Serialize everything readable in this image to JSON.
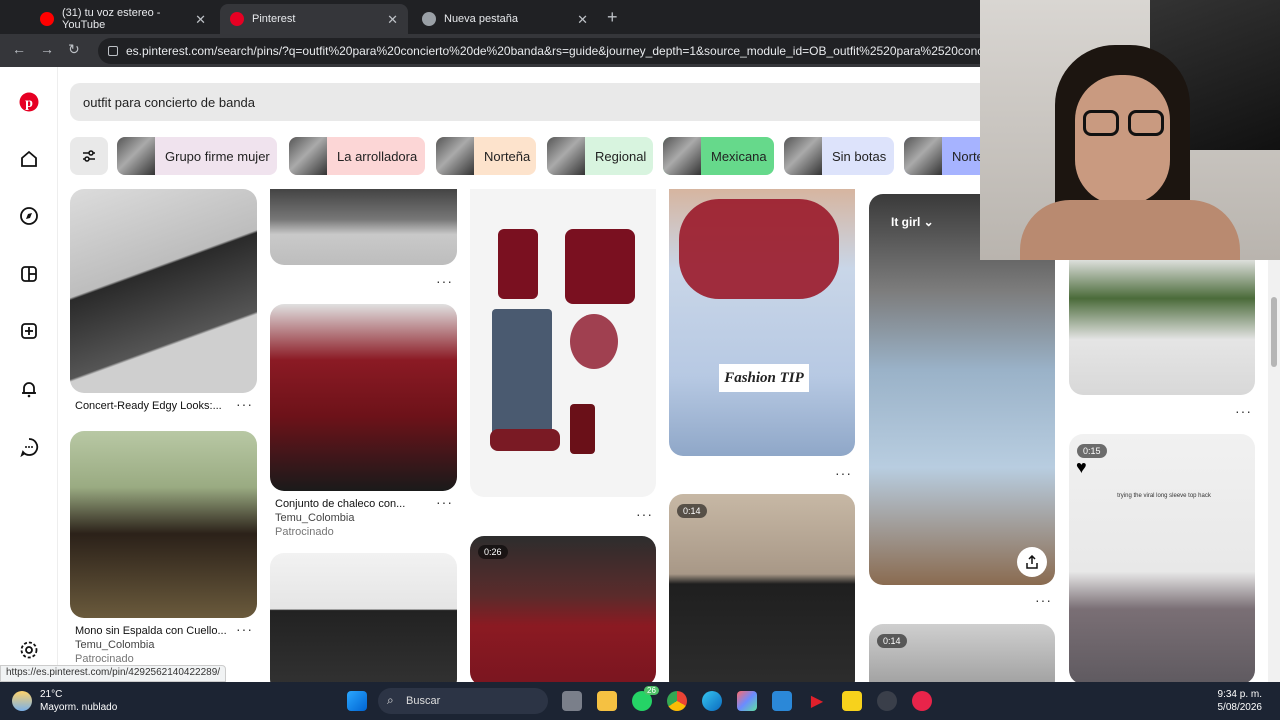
{
  "browser": {
    "tabs": [
      {
        "label": "(31) tu voz estereo - YouTube",
        "color": "#ff0000"
      },
      {
        "label": "Pinterest",
        "color": "#e60023"
      },
      {
        "label": "Nueva pestaña",
        "color": "#9aa0a6"
      }
    ],
    "url": "es.pinterest.com/search/pins/?q=outfit%20para%20concierto%20de%20banda&rs=guide&journey_depth=1&source_module_id=OB_outfit%2520para%2520concierto%2520"
  },
  "search": {
    "query": "outfit para concierto de banda"
  },
  "chips": [
    {
      "label": "Grupo firme mujer",
      "bg": "#f0e3ee"
    },
    {
      "label": "La arrolladora",
      "bg": "#fcd6d6"
    },
    {
      "label": "Norteña",
      "bg": "#fde3cc"
    },
    {
      "label": "Regional",
      "bg": "#d8f4df"
    },
    {
      "label": "Mexicana",
      "bg": "#66d98b"
    },
    {
      "label": "Sin botas",
      "bg": "#dde3fb"
    },
    {
      "label": "Norte",
      "bg": "#a6b3ff"
    }
  ],
  "pins": {
    "p1_title": "Concert-Ready Edgy Looks:...",
    "p2_title": "Mono sin Espalda con Cuello...",
    "p2_brand": "Temu_Colombia",
    "p2_spons": "Patrocinado",
    "p3_title": "Conjunto de chaleco con...",
    "p3_brand": "Temu_Colombia",
    "p3_spons": "Patrocinado",
    "fashion_tip": "Fashion TIP",
    "it_girl": "It girl",
    "viral_text": "trying the viral long sleeve top hack",
    "dur_a": "0:26",
    "dur_b": "0:14",
    "dur_c": "0:14",
    "dur_d": "0:15"
  },
  "status_url": "https://es.pinterest.com/pin/4292562140422289/",
  "taskbar": {
    "temp": "21°C",
    "weather": "Mayorm. nublado",
    "search": "Buscar",
    "time": "9:34 p. m.",
    "date": "5/08/2026",
    "badge": "26"
  }
}
